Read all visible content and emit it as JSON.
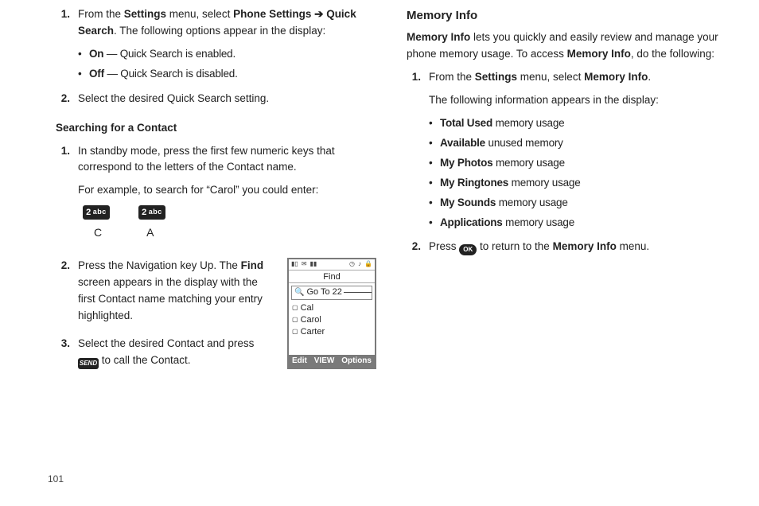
{
  "page_number": "101",
  "left": {
    "step1": {
      "num": "1.",
      "text_pre": "From the ",
      "settings": "Settings",
      "text_mid": " menu, select ",
      "phone_settings": "Phone Settings",
      "arrow": "➔",
      "quick_search": "Quick Search",
      "text_post": ". The following options appear in the display:",
      "bullet_on_label": "On",
      "bullet_on_text": " — Quick Search is enabled.",
      "bullet_off_label": "Off",
      "bullet_off_text": " — Quick Search is disabled."
    },
    "step2_top": {
      "num": "2.",
      "text": "Select the desired Quick Search setting."
    },
    "searching_heading": "Searching for a Contact",
    "s1": {
      "num": "1.",
      "p1": "In standby mode, press the first few numeric keys that correspond to the letters of the Contact name.",
      "p2": "For example, to search for “Carol” you could enter:",
      "key1num": "2",
      "key1abc": "abc",
      "key2num": "2",
      "key2abc": "abc",
      "letterC": "C",
      "letterA": "A"
    },
    "s2": {
      "num": "2.",
      "pre": "Press the Navigation key Up. The ",
      "find": "Find",
      "post": " screen appears in the display with the first Contact name matching your entry highlighted."
    },
    "s3": {
      "num": "3.",
      "pre": "Select the desired Contact and press ",
      "send": "SEND",
      "post": " to call the Contact."
    },
    "phone": {
      "status_signal": "▮▯",
      "status_msg": "✉",
      "status_batt": "▮▮",
      "status_clock": "◷",
      "status_bell": "♪",
      "status_lock": "🔒",
      "title": "Find",
      "input": "Go To 22",
      "row1": "Cal",
      "row2": "Carol",
      "row3": "Carter",
      "soft_left": "Edit",
      "soft_mid": "VIEW",
      "soft_right": "Options"
    }
  },
  "right": {
    "heading": "Memory Info",
    "intro_b1": "Memory Info",
    "intro_1": " lets you quickly and easily review and manage your phone memory usage. To access ",
    "intro_b2": "Memory Info",
    "intro_2": ", do the following:",
    "r1": {
      "num": "1.",
      "pre": "From the ",
      "settings": "Settings",
      "mid": " menu, select ",
      "mem": "Memory Info",
      "post": ".",
      "p2": "The following information appears in the display:",
      "b1_label": "Total Used",
      "b1_t": " memory usage",
      "b2_label": "Available",
      "b2_t": " unused memory",
      "b3_label": "My Photos",
      "b3_t": " memory usage",
      "b4_label": "My Ringtones",
      "b4_t": " memory usage",
      "b5_label": "My Sounds",
      "b5_t": " memory usage",
      "b6_label": "Applications",
      "b6_t": " memory usage"
    },
    "r2": {
      "num": "2.",
      "pre": "Press ",
      "ok": "OK",
      "mid": " to return to the ",
      "mem": "Memory Info",
      "post": " menu."
    }
  }
}
